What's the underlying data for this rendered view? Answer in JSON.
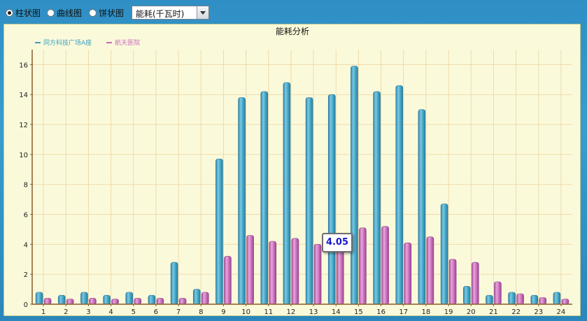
{
  "toolbar": {
    "options": [
      {
        "label": "柱状图",
        "selected": true
      },
      {
        "label": "曲线图",
        "selected": false
      },
      {
        "label": "饼状图",
        "selected": false
      }
    ],
    "metric_select": "能耗(千瓦时)"
  },
  "tooltip": "4.05",
  "colors": {
    "series1": "#3a9fbf",
    "series2": "#c66ab8",
    "background": "#fafadb",
    "grid": "#f0d9a8"
  },
  "chart_data": {
    "type": "bar",
    "title": "能耗分析",
    "xlabel": "",
    "ylabel": "",
    "categories": [
      "1",
      "2",
      "3",
      "4",
      "5",
      "6",
      "7",
      "8",
      "9",
      "10",
      "11",
      "12",
      "13",
      "14",
      "15",
      "16",
      "17",
      "18",
      "19",
      "20",
      "21",
      "22",
      "23",
      "24"
    ],
    "ylim": [
      0,
      17
    ],
    "yticks": [
      0,
      2,
      4,
      6,
      8,
      10,
      12,
      14,
      16
    ],
    "grid": true,
    "legend_position": "top-left",
    "series": [
      {
        "name": "同方科技广场A座",
        "color": "#3a9fbf",
        "values": [
          0.8,
          0.6,
          0.8,
          0.6,
          0.8,
          0.6,
          2.8,
          1.0,
          9.7,
          13.8,
          14.2,
          14.8,
          13.8,
          14.0,
          15.9,
          14.2,
          14.6,
          13.0,
          6.7,
          1.2,
          0.6,
          0.8,
          0.6,
          0.8
        ]
      },
      {
        "name": "航天医院",
        "color": "#c66ab8",
        "values": [
          0.4,
          0.35,
          0.4,
          0.35,
          0.4,
          0.4,
          0.4,
          0.8,
          3.2,
          4.6,
          4.2,
          4.4,
          4.0,
          4.05,
          5.1,
          5.2,
          4.1,
          4.5,
          3.0,
          2.8,
          1.5,
          0.7,
          0.45,
          0.35
        ]
      }
    ]
  }
}
